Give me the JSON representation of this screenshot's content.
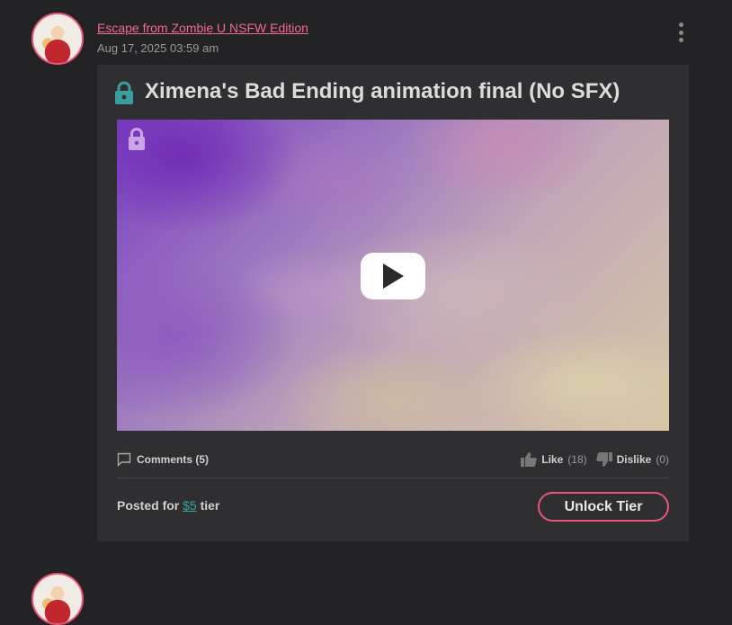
{
  "post": {
    "author": "Escape from Zombie U NSFW Edition",
    "date": "Aug 17, 2025 03:59 am",
    "title": "Ximena's Bad Ending animation final (No SFX)",
    "comments_label": "Comments (5)",
    "like_label": "Like",
    "like_count": "(18)",
    "dislike_label": "Dislike",
    "dislike_count": "(0)",
    "tier_prefix": "Posted for",
    "tier_price": "$5",
    "tier_suffix": "tier",
    "unlock_label": "Unlock Tier"
  },
  "icons": {
    "title_lock": "lock-icon",
    "media_lock": "lock-icon",
    "play": "play-icon",
    "comments": "comment-icon",
    "like": "thumbs-up-icon",
    "dislike": "thumbs-down-icon",
    "menu": "kebab-menu-icon"
  },
  "colors": {
    "background": "#232224",
    "card": "#2f2f31",
    "accent_pink": "#e8557a",
    "link_teal": "#3aa3a5",
    "lock_teal": "#3a9e9e",
    "media_lock": "#c9a6e6"
  }
}
